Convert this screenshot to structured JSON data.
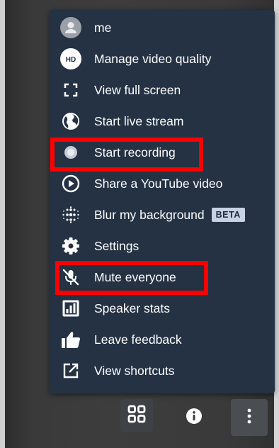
{
  "menu": {
    "items": [
      {
        "label": "me",
        "icon": "avatar-icon"
      },
      {
        "label": "Manage video quality",
        "icon": "hd-icon",
        "icon_text": "HD"
      },
      {
        "label": "View full screen",
        "icon": "fullscreen-icon"
      },
      {
        "label": "Start live stream",
        "icon": "globe-icon"
      },
      {
        "label": "Start recording",
        "icon": "record-icon"
      },
      {
        "label": "Share a YouTube video",
        "icon": "play-circle-icon"
      },
      {
        "label": "Blur my background",
        "icon": "blur-icon",
        "badge": "BETA"
      },
      {
        "label": "Settings",
        "icon": "gear-icon"
      },
      {
        "label": "Mute everyone",
        "icon": "mic-off-icon"
      },
      {
        "label": "Speaker stats",
        "icon": "bar-chart-icon"
      },
      {
        "label": "Leave feedback",
        "icon": "thumbs-up-icon"
      },
      {
        "label": "View shortcuts",
        "icon": "external-link-icon"
      }
    ]
  },
  "toolbar": {
    "buttons": [
      {
        "icon": "tile-view-icon"
      },
      {
        "icon": "info-icon"
      },
      {
        "icon": "more-vertical-icon"
      }
    ]
  },
  "colors": {
    "menu_bg": "#243244",
    "highlight": "#ff0000",
    "badge_bg": "#c8d2e6"
  }
}
